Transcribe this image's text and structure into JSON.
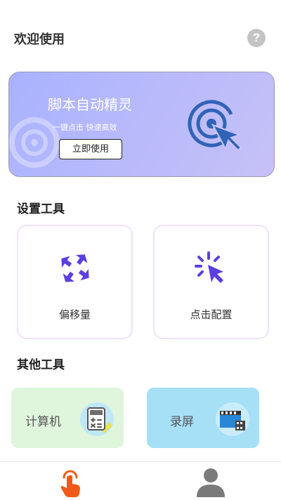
{
  "header": {
    "title": "欢迎使用",
    "help_icon": "question-circle-icon",
    "help_glyph": "?"
  },
  "banner": {
    "title": "脚本自动精灵",
    "subtitle": "一键点击  快速高效",
    "cta_label": "立即使用",
    "icon": "target-cursor-icon"
  },
  "settings_tools": {
    "title": "设置工具",
    "items": [
      {
        "label": "偏移量",
        "icon": "move-arrows-icon"
      },
      {
        "label": "点击配置",
        "icon": "click-cursor-icon"
      }
    ]
  },
  "other_tools": {
    "title": "其他工具",
    "items": [
      {
        "label": "计算机",
        "icon": "calculator-icon",
        "bg": "#dff5dc"
      },
      {
        "label": "录屏",
        "icon": "screen-record-icon",
        "bg": "#a6e0f7"
      }
    ]
  },
  "tabbar": {
    "items": [
      {
        "icon": "tap-hand-icon",
        "active": true
      },
      {
        "icon": "user-profile-icon",
        "active": false
      }
    ]
  },
  "colors": {
    "accent": "#5b3fe0",
    "banner_icon": "#2f63b8",
    "tab_active": "#ef5b16",
    "tab_inactive": "#7a7a7a"
  }
}
